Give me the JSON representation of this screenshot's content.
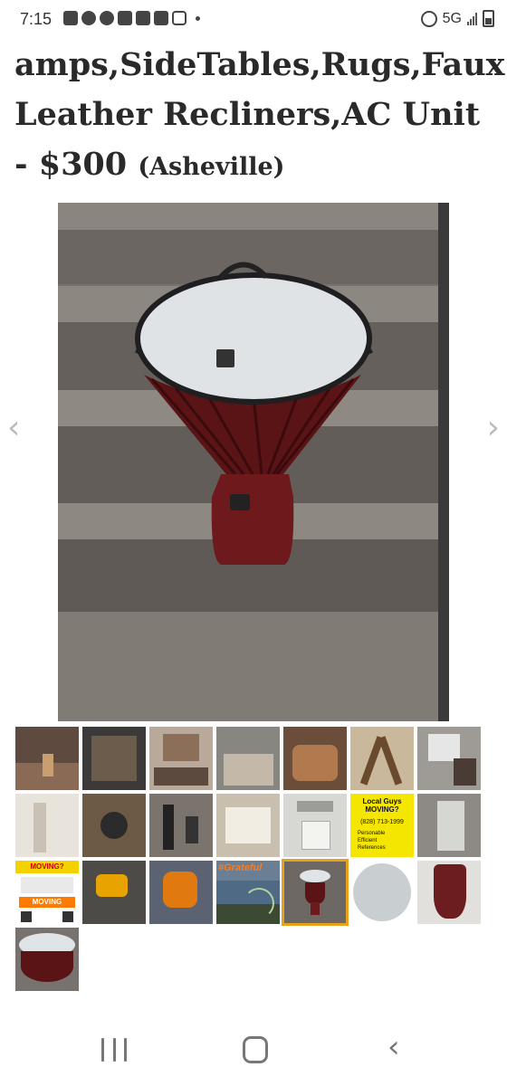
{
  "status_bar": {
    "time": "7:15",
    "network": "5G",
    "left_icons": [
      "chat-icon",
      "facebook-icon",
      "check-badge-icon",
      "youtube-icon",
      "youtube-icon",
      "mail-icon",
      "instagram-icon",
      "dot-icon"
    ],
    "right_icons": [
      "alarm-icon",
      "signal-icon",
      "battery-icon"
    ]
  },
  "listing": {
    "title_main": "amps,SideTables,Rugs,Faux Leather Recliners,AC Unit - $300 ",
    "location": "(Asheville)"
  },
  "gallery": {
    "main_image": "djembe-drum-on-concrete-steps",
    "prev_arrow": "‹",
    "next_arrow": "›",
    "thumbnails": [
      "garage-contents",
      "loaded-moving-truck",
      "furniture-in-truck",
      "truck-interior-boxes",
      "leather-chairs-in-truck",
      "rocking-chair",
      "storage-items",
      "white-wall-room",
      "cart-wheels",
      "hand-truck",
      "moving-flyer-paper",
      "fridge-ice-dispenser",
      "local-guys-moving-sign",
      "appliance-in-truck",
      "moving-ad-flyer",
      "leaf-blower-gravel",
      "blue-leaf-blower",
      "grateful-rainbow-sky",
      "djembe-drum-selected",
      "drum-head-top",
      "drum-body-side",
      "djembe-drum-steps"
    ],
    "selected_index": 18
  },
  "thumb_text": {
    "grateful": "#Grateful",
    "moving_sign_title": "Local Guys MOVING?",
    "moving_sign_phone": "(828) 713-1999",
    "moving_sign_bullets": [
      "Personable",
      "Efficient",
      "References"
    ],
    "flyer_headline": "MOVING?",
    "flyer_sub": "MOVING"
  },
  "nav_bar": {
    "recent": "recent-apps-icon",
    "home": "home-icon",
    "back": "back-icon"
  }
}
